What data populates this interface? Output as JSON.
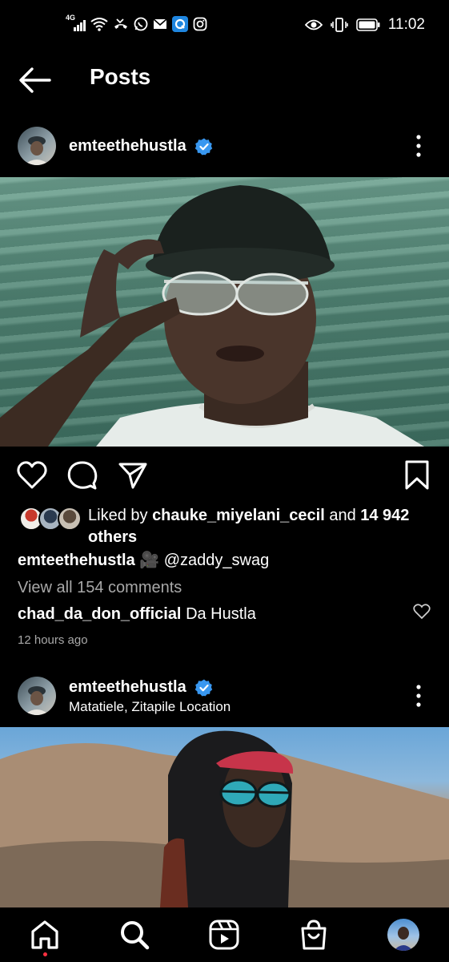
{
  "status_bar": {
    "network": "4G",
    "time": "11:02"
  },
  "top_bar": {
    "title": "Posts"
  },
  "post1": {
    "username": "emteethehustla",
    "liked_by_prefix": "Liked by ",
    "liked_by_user": "chauke_miyelani_cecil",
    "liked_by_and": " and ",
    "likes_count": "14 942",
    "likes_others": "others",
    "caption_user": "emteethehustla",
    "caption_text": "🎥 @zaddy_swag",
    "view_comments": "View all 154 comments",
    "comment_user": "chad_da_don_official",
    "comment_text": "Da Hustla",
    "timestamp": "12 hours ago"
  },
  "post2": {
    "username": "emteethehustla",
    "location": "Matatiele, Zitapile Location"
  },
  "colors": {
    "verified": "#3897f0",
    "background": "#000000",
    "muted": "#a8a8a8",
    "notification": "#ff3040"
  }
}
